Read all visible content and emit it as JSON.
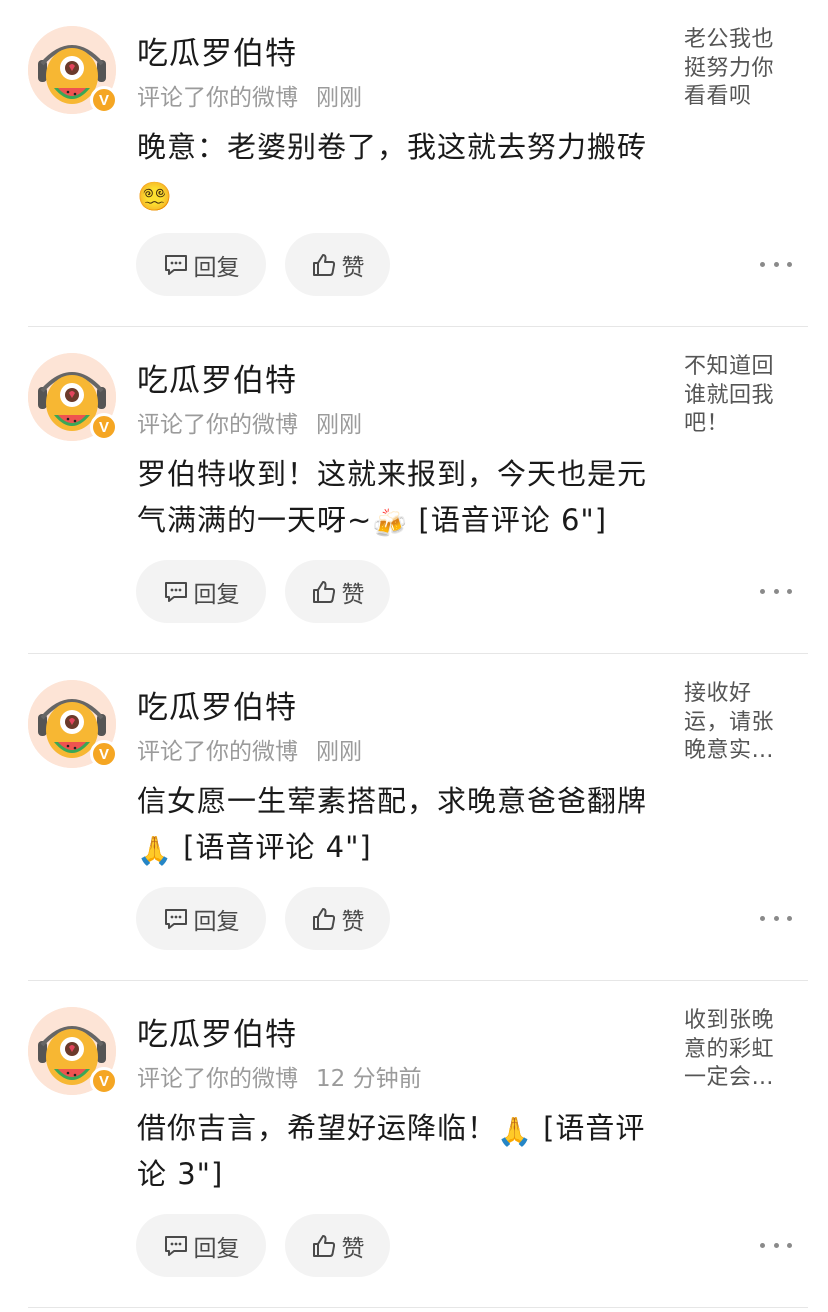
{
  "colors": {
    "text": "#1a1a1a",
    "meta": "#9b9b9b",
    "button_bg": "#f3f3f3",
    "divider": "#e6e6e6",
    "verified_badge": "#f5a623"
  },
  "comments": [
    {
      "user": "吃瓜罗伯特",
      "verified_badge": "V",
      "action": "评论了你的微博",
      "time": "刚刚",
      "content": "晚意：老婆别卷了，我这就去努力搬砖",
      "emoji": "😵‍💫",
      "voice_tag": "",
      "quoted_post": "老公我也挺努力你看看呗",
      "reply_label": "回复",
      "like_label": "赞"
    },
    {
      "user": "吃瓜罗伯特",
      "verified_badge": "V",
      "action": "评论了你的微博",
      "time": "刚刚",
      "content": "罗伯特收到！这就来报到，今天也是元气满满的一天呀~",
      "emoji": "🍻",
      "voice_tag": "[语音评论 6\"]",
      "quoted_post": "不知道回谁就回我吧！",
      "reply_label": "回复",
      "like_label": "赞"
    },
    {
      "user": "吃瓜罗伯特",
      "verified_badge": "V",
      "action": "评论了你的微博",
      "time": "刚刚",
      "content": "信女愿一生荤素搭配，求晚意爸爸翻牌",
      "emoji": "🙏",
      "voice_tag": "[语音评论 4\"]",
      "quoted_post": "接收好运，请张晚意实…",
      "reply_label": "回复",
      "like_label": "赞"
    },
    {
      "user": "吃瓜罗伯特",
      "verified_badge": "V",
      "action": "评论了你的微博",
      "time": "12 分钟前",
      "content": "借你吉言，希望好运降临！",
      "emoji": "🙏",
      "voice_tag": "[语音评论 3\"]",
      "quoted_post": "收到张晚意的彩虹一定会…",
      "reply_label": "回复",
      "like_label": "赞"
    }
  ]
}
